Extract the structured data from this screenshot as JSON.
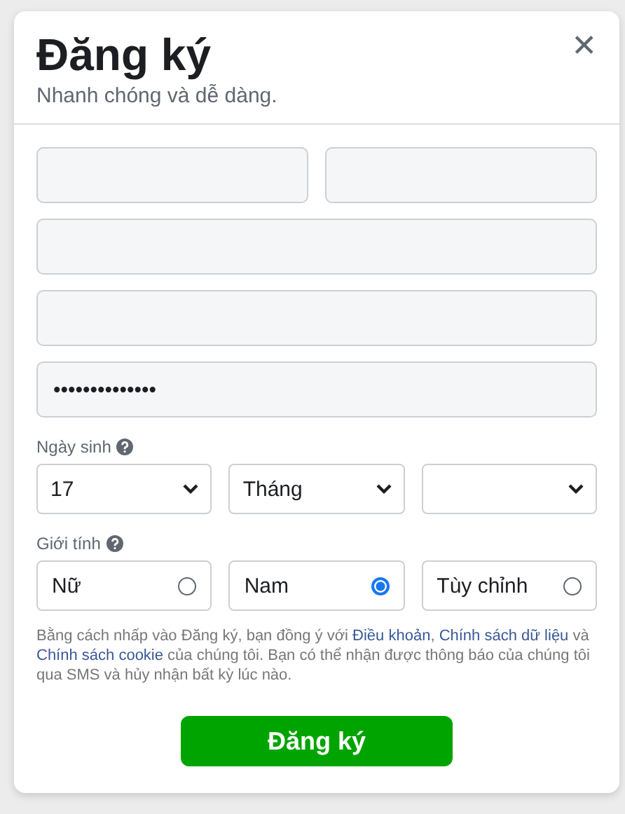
{
  "dialog": {
    "title": "Đăng ký",
    "subtitle": "Nhanh chóng và dễ dàng.",
    "close": "✕"
  },
  "fields": [
    {
      "kind": "half"
    },
    {
      "kind": "half"
    },
    {
      "kind": "full"
    },
    {
      "kind": "full"
    },
    {
      "kind": "full",
      "value": "••••••••••••••"
    }
  ],
  "birthday": {
    "label": "Ngày sinh",
    "selects": [
      "17",
      "Tháng"
    ]
  },
  "gender": {
    "label": "Giới tính",
    "options": [
      {
        "label": "Nữ",
        "selected": false
      },
      {
        "label": "Nam",
        "selected": true
      },
      {
        "label": "Tùy chỉnh",
        "selected": false
      }
    ]
  },
  "terms": [
    {
      "kind": "text",
      "text": "Bằng cách nhấp vào Đăng ký, bạn đồng ý với "
    },
    {
      "kind": "link",
      "text": "Điều khoản"
    },
    {
      "kind": "text",
      "text": ", "
    },
    {
      "kind": "link",
      "text": "Chính sách dữ liệu"
    },
    {
      "kind": "text",
      "text": " và "
    },
    {
      "kind": "link",
      "text": "Chính sách cookie"
    },
    {
      "kind": "text",
      "text": " của chúng tôi. Bạn có thể nhận được thông báo của chúng tôi qua SMS và hủy nhận bất kỳ lúc nào."
    }
  ],
  "submit": "Đăng ký"
}
